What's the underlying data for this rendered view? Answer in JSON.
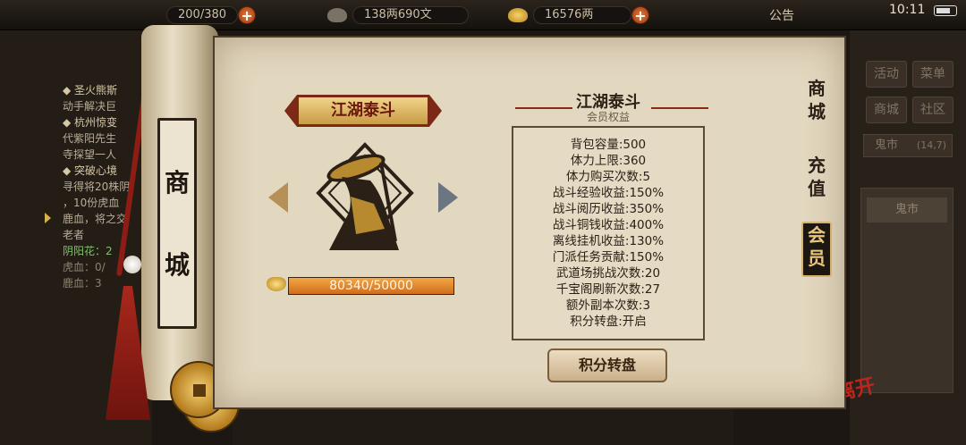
{
  "topbar": {
    "resource1": "200/380",
    "resource2": "138两690文",
    "resource3": "16576两",
    "notice": "公告",
    "time": "10:11"
  },
  "left_panel": {
    "quests": [
      "◆ 圣火熊斯",
      "动手解决巨",
      "◆ 杭州惊变",
      "代紫阳先生",
      "寺探望一人",
      "◆ 突破心境",
      "寻得将20株阴",
      "，10份虎血",
      "鹿血，将之交",
      "老者",
      "阴阳花：2",
      "虎血：0/",
      "鹿血：3"
    ]
  },
  "right_panel": {
    "buttons": [
      "活动",
      "菜单",
      "商城",
      "社区"
    ],
    "ghost_market": "鬼市",
    "ghost_market_coords": "(14,7)",
    "list_item": "鬼市",
    "leave": "离开"
  },
  "scroll_title": [
    "商",
    "城"
  ],
  "tabs": [
    {
      "label": "商城"
    },
    {
      "label": "充值"
    },
    {
      "label": "会员"
    }
  ],
  "vip": {
    "name": "江湖泰斗",
    "progress_text": "80340/50000",
    "progress_fraction": 1.0
  },
  "benefits": {
    "title": "江湖泰斗",
    "subtitle": "会员权益",
    "items": [
      "背包容量:500",
      "体力上限:360",
      "体力购买次数:5",
      "战斗经验收益:150%",
      "战斗阅历收益:350%",
      "战斗铜钱收益:400%",
      "离线挂机收益:130%",
      "门派任务贡献:150%",
      "武道场挑战次数:20",
      "千宝阁刷新次数:27",
      "额外副本次数:3",
      "积分转盘:开启"
    ],
    "button": "积分转盘"
  }
}
